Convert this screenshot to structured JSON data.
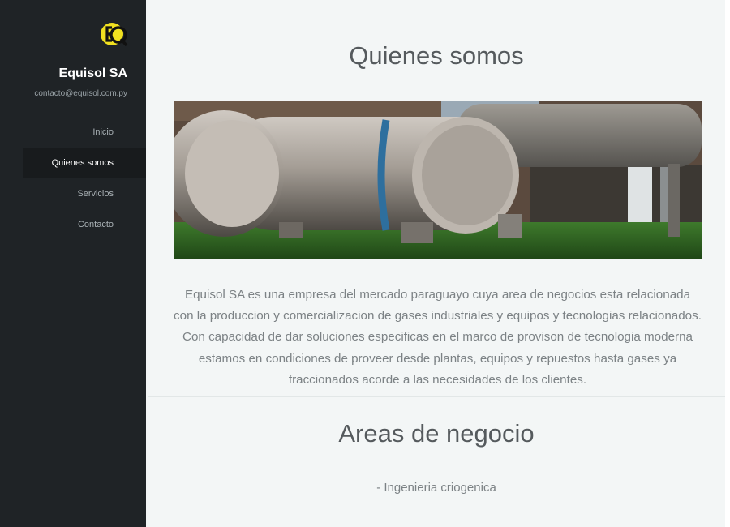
{
  "sidebar": {
    "brand_name": "Equisol SA",
    "email": "contacto@equisol.com.py",
    "logo_icon": "equisol-eq-logo",
    "nav": [
      {
        "label": "Inicio",
        "active": false
      },
      {
        "label": "Quienes somos",
        "active": true
      },
      {
        "label": "Servicios",
        "active": false
      },
      {
        "label": "Contacto",
        "active": false
      }
    ]
  },
  "about": {
    "title": "Quienes somos",
    "text": "Equisol SA es una empresa del mercado paraguayo cuya area de negocios esta relacionada con la produccion y comercializacion de gases industriales y equipos y tecnologias relacionados. Con capacidad de dar soluciones especificas en el marco de provison de tecnologia moderna estamos en condiciones de proveer desde plantas, equipos y repuestos hasta gases ya fraccionados acorde a las necesidades de los clientes."
  },
  "areas": {
    "title": "Areas de negocio",
    "items": [
      "- Ingenieria criogenica"
    ]
  },
  "colors": {
    "sidebar_bg": "#1f2326",
    "accent_yellow": "#f0e020",
    "page_bg": "#f3f6f6"
  }
}
